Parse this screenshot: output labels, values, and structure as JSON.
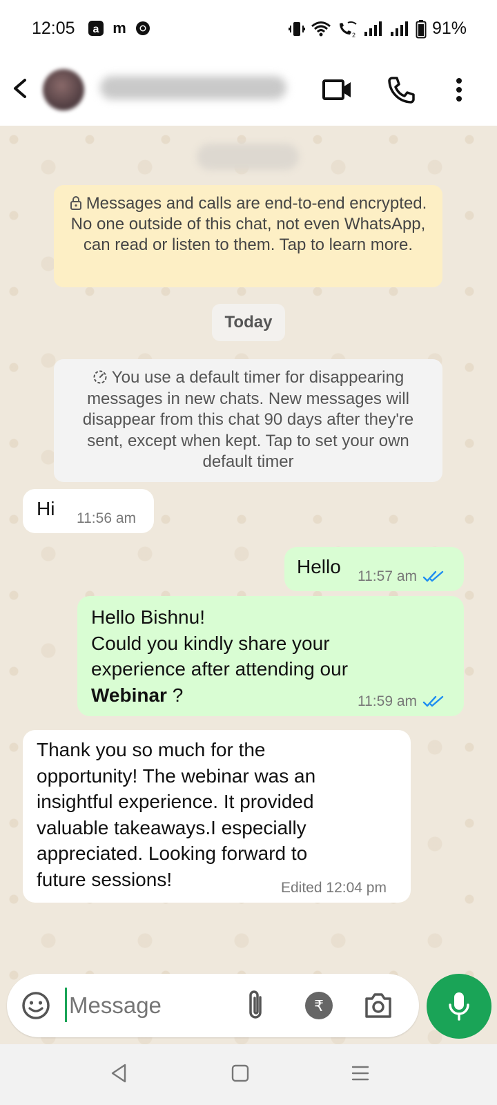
{
  "status_bar": {
    "time": "12:05",
    "battery": "91%",
    "app_icons": [
      "amazon-icon",
      "m-app-icon",
      "chrome-icon"
    ]
  },
  "header": {
    "contact_name": "",
    "icons": [
      "back-arrow-icon",
      "video-call-icon",
      "voice-call-icon",
      "more-options-icon"
    ]
  },
  "chat": {
    "encryption_notice": "Messages and calls are end-to-end encrypted. No one outside of this chat, not even WhatsApp, can read or listen to them. Tap to learn more.",
    "date_chip": "Today",
    "timer_notice": "You use a default timer for disappearing messages in new chats. New messages will disappear from this chat 90 days after they're sent, except when kept. Tap to set your own default timer",
    "messages": [
      {
        "direction": "incoming",
        "text": "Hi",
        "time": "11:56 am"
      },
      {
        "direction": "outgoing",
        "text": "Hello",
        "time": "11:57 am",
        "status": "read"
      },
      {
        "direction": "outgoing",
        "line1": "Hello Bishnu!",
        "line2": "Could you kindly share your experience after attending our",
        "bold": "Webinar",
        "tail": " ?",
        "time": "11:59 am",
        "status": "read"
      },
      {
        "direction": "incoming",
        "text": "Thank you so much for the opportunity! The webinar was an insightful experience. It provided valuable takeaways.I especially appreciated. Looking forward to future sessions!",
        "edited": "Edited",
        "time": "12:04 pm"
      }
    ]
  },
  "input": {
    "placeholder": "Message",
    "icons": [
      "emoji-icon",
      "attach-icon",
      "rupee-payment-icon",
      "camera-icon",
      "mic-icon"
    ]
  },
  "nav": {
    "icons": [
      "nav-back-icon",
      "nav-home-icon",
      "nav-menu-icon"
    ]
  },
  "colors": {
    "accent_green": "#1aa457",
    "outgoing_bubble": "#d9fdd3",
    "encryption_bg": "#fdefc5",
    "read_ticks": "#1f8ef1"
  }
}
